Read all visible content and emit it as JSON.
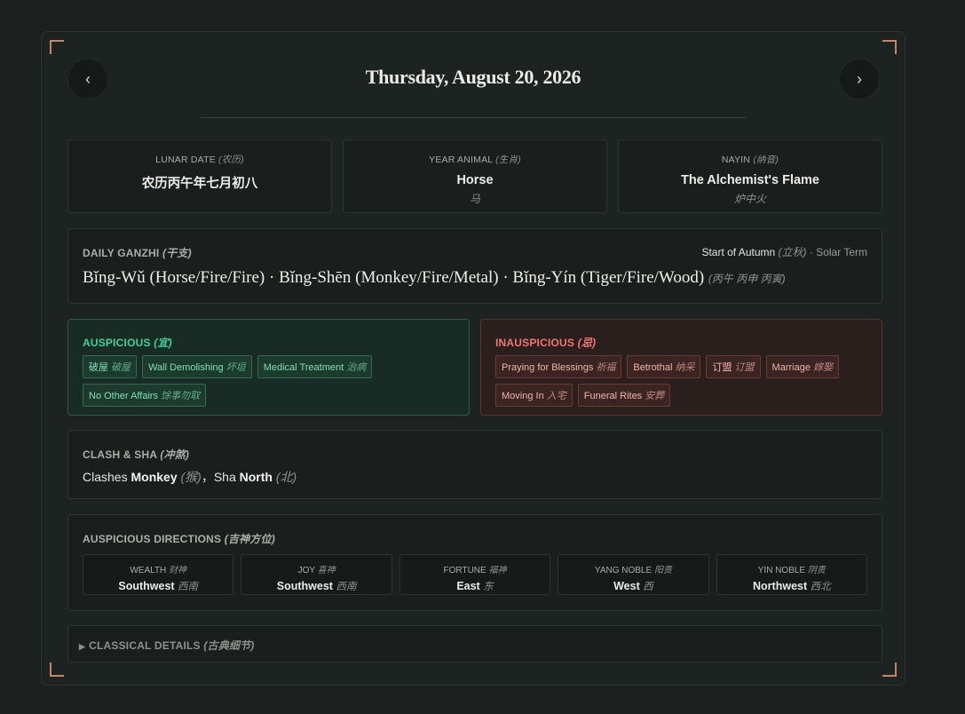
{
  "header": {
    "prev_label": "‹",
    "next_label": "›",
    "date": "Thursday, August 20, 2026"
  },
  "info_cards": [
    {
      "label": "LUNAR DATE",
      "label_cn": "(农历)",
      "value": "农历丙午年七月初八",
      "sub": ""
    },
    {
      "label": "YEAR ANIMAL",
      "label_cn": "(生肖)",
      "value": "Horse",
      "sub": "马"
    },
    {
      "label": "NAYIN",
      "label_cn": "(纳音)",
      "value": "The Alchemist's Flame",
      "sub": "炉中火"
    }
  ],
  "ganzhi": {
    "label": "DAILY GANZHI",
    "label_cn": "(干支)",
    "solar_term": "Start of Autumn",
    "solar_term_cn": "(立秋)",
    "solar_suffix": "· Solar Term",
    "text": "Bǐng-Wǔ (Horse/Fire/Fire) · Bǐng-Shēn (Monkey/Fire/Metal) · Bǐng-Yín (Tiger/Fire/Wood)",
    "text_cn": "(丙午 丙申 丙寅)"
  },
  "auspicious": {
    "label": "AUSPICIOUS",
    "label_cn": "(宜)",
    "tags": [
      {
        "en": "破屋",
        "cn": "破屋"
      },
      {
        "en": "Wall Demolishing",
        "cn": "坏垣"
      },
      {
        "en": "Medical Treatment",
        "cn": "治病"
      },
      {
        "en": "No Other Affairs",
        "cn": "馀事勿取"
      }
    ]
  },
  "inauspicious": {
    "label": "INAUSPICIOUS",
    "label_cn": "(忌)",
    "tags": [
      {
        "en": "Praying for Blessings",
        "cn": "祈福"
      },
      {
        "en": "Betrothal",
        "cn": "纳采"
      },
      {
        "en": "订盟",
        "cn": "订盟"
      },
      {
        "en": "Marriage",
        "cn": "嫁娶"
      },
      {
        "en": "Moving In",
        "cn": "入宅"
      },
      {
        "en": "Funeral Rites",
        "cn": "安葬"
      }
    ]
  },
  "clash": {
    "label": "CLASH & SHA",
    "label_cn": "(冲煞)",
    "clashes_prefix": "Clashes",
    "clash_animal": "Monkey",
    "clash_animal_cn": "(猴)",
    "sha_prefix": "，Sha",
    "sha_direction": "North",
    "sha_direction_cn": "(北)"
  },
  "directions": {
    "label": "AUSPICIOUS DIRECTIONS",
    "label_cn": "(吉神方位)",
    "items": [
      {
        "label": "WEALTH",
        "label_cn": "财神",
        "value": "Southwest",
        "value_cn": "西南"
      },
      {
        "label": "JOY",
        "label_cn": "喜神",
        "value": "Southwest",
        "value_cn": "西南"
      },
      {
        "label": "FORTUNE",
        "label_cn": "福神",
        "value": "East",
        "value_cn": "东"
      },
      {
        "label": "YANG NOBLE",
        "label_cn": "阳贵",
        "value": "West",
        "value_cn": "西"
      },
      {
        "label": "YIN NOBLE",
        "label_cn": "阴贵",
        "value": "Northwest",
        "value_cn": "西北"
      }
    ]
  },
  "classical": {
    "label": "CLASSICAL DETAILS",
    "label_cn": "(古典细节)"
  },
  "colors": {
    "accent_corner": "#c78468",
    "auspicious": "#3fd196",
    "inauspicious": "#f17474"
  }
}
